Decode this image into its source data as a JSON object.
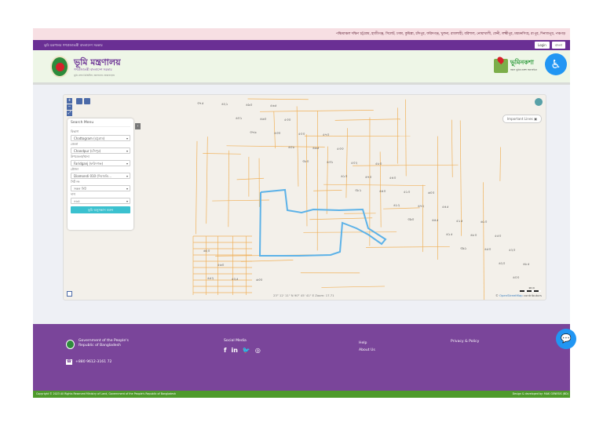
{
  "ticker": "পঞ্চিমাঞ্চল দক্ষিণ চট্টগ্রাম, হাজীগঞ্জ, সিলেট, ঢাকা, কুমিল্লা, চাঁদপুর, ফরিদগঞ্জ, খুলনা, রাজশাহী, বরিশাল, নোয়াখালী, ফেনী, লক্ষ্মীপুর, ময়মনসিংহ, রংপুর, দিনাজপুর, পঞ্চগড়",
  "topbar": {
    "title": "ভূমি মন্ত্রণালয় গণপ্রজাতন্ত্রী বাংলাদেশ সরকার",
    "login": "Login",
    "language": "বাংলা"
  },
  "header": {
    "brand": "ভূমি মন্ত্রণালয়",
    "subtitle": "গণপ্রজাতন্ত্রী বাংলাদেশ সরকার",
    "tagline": "ভূমি সেবা ডিজিটাল, জনগণের দোরগোড়ায়",
    "service_name": "ভূমিনকশা",
    "service_tagline": "সকল ভূমির নকশা অনলাইনে",
    "accessibility_icon": "wheelchair-icon"
  },
  "map": {
    "panel": {
      "title": "Search Menu",
      "fields": [
        {
          "label": "বিভাগ",
          "value": "Chattogram (চট্টগ্রাম)"
        },
        {
          "label": "জেলা",
          "value": "Chandpur (চাঁদপুর)"
        },
        {
          "label": "উপজেলা/থানা",
          "value": "Faridganj (ফরিদগঞ্জ)"
        },
        {
          "label": "মৌজা",
          "value": "Diamondi 010 (দিয়ামন্ডি..."
        },
        {
          "label": "সিট নং",
          "value": "সকল সিট"
        },
        {
          "label": "দাগ",
          "value": "৪৬৫"
        }
      ],
      "submit": "ভূমি অনুসন্ধান করুন"
    },
    "important_lines": "Important Lines",
    "coordinates": "23° 12' 11\" N 90° 45' 41\" E  Zoom: 17.71",
    "scale": "10 m",
    "attribution_prefix": "©",
    "attribution_link": "OpenStreetMap",
    "attribution_suffix": "contributors",
    "plots": [
      "৩৭৫",
      "৩৭৬",
      "৩৮০",
      "৩৮১",
      "৩৯০",
      "৩৯১",
      "৪০০",
      "৪০১",
      "৪০৮",
      "৪১০",
      "৪১২",
      "৪১৫",
      "৪২০",
      "৪২১",
      "৪৩০",
      "৪৩১",
      "৪৪০",
      "৪৪৫",
      "৪৫০",
      "৪৫২",
      "৪৬০",
      "৪৬৫",
      "৪৭০",
      "৪৭২",
      "৪৮০",
      "৪৮৫",
      "৪৯০",
      "৫০০",
      "৫০২",
      "৫১০",
      "৫১৫",
      "৫২০",
      "৫২৫",
      "৫৩০",
      "৫৩৩",
      "৫৪০",
      "৫৪৫",
      "৫৫০",
      "৫৬০",
      "৫৬৫",
      "৫৭০",
      "৫৮০",
      "৬০০",
      "৬১০",
      "৬২০",
      "৬৩০"
    ],
    "colors": {
      "parcel": "#f0b15a",
      "selection": "#5cb2e8"
    }
  },
  "footer": {
    "gov_line1": "Government of the People's",
    "gov_line2": "Republic of Bangladesh",
    "phone": "+880 9612-3161 72",
    "social_title": "Social Media",
    "social": [
      "f",
      "in",
      "🐦",
      "◎"
    ],
    "help": "Help",
    "about": "About Us",
    "privacy": "Privacy & Policy",
    "copyright": "Copyright © 2023 All Rights Reserved Ministry of Land, Government of the People's Republic of Bangladesh",
    "credit": "Design & developed by: MAK GENESIS (BD)"
  }
}
